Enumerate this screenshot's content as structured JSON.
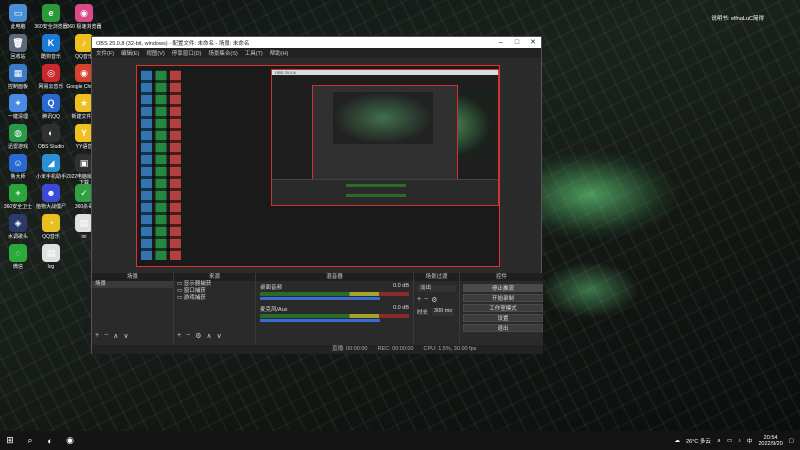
{
  "desktop": {
    "user_label": "说明书: elfnaLuC简得",
    "icons": [
      {
        "label": "此电脑",
        "glyph": "▭",
        "color": "#4a8fd6"
      },
      {
        "label": "360安全浏览器",
        "glyph": "e",
        "color": "#2b9b3a"
      },
      {
        "label": "360 极速浏览器",
        "glyph": "◉",
        "color": "#d84a8a"
      },
      {
        "label": "回收站",
        "glyph": "🗑",
        "color": "#5a6a7a"
      },
      {
        "label": "酷狗音乐",
        "glyph": "K",
        "color": "#1a7ad6"
      },
      {
        "label": "QQ音乐",
        "glyph": "♪",
        "color": "#f0c020"
      },
      {
        "label": "控制面板",
        "glyph": "▦",
        "color": "#3a7ac6"
      },
      {
        "label": "网易云音乐",
        "glyph": "◎",
        "color": "#c8282e"
      },
      {
        "label": "Google Chrome",
        "glyph": "◉",
        "color": "#d84030"
      },
      {
        "label": "一键清理",
        "glyph": "✦",
        "color": "#4a8ae6"
      },
      {
        "label": "腾讯QQ",
        "glyph": "Q",
        "color": "#2a6ad0"
      },
      {
        "label": "新建文件夹",
        "glyph": "★",
        "color": "#f0c020"
      },
      {
        "label": "迅雷游戏",
        "glyph": "◍",
        "color": "#2a9a4a"
      },
      {
        "label": "OBS Studio",
        "glyph": "◐",
        "color": "#303030"
      },
      {
        "label": "YY语音",
        "glyph": "Y",
        "color": "#f0c020"
      },
      {
        "label": "鲁大师",
        "glyph": "☺",
        "color": "#2a6ad0"
      },
      {
        "label": "小米手机助手",
        "glyph": "◢",
        "color": "#2a90d6"
      },
      {
        "label": "2022电脑版软件下载",
        "glyph": "▣",
        "color": "#303030"
      },
      {
        "label": "360安全卫士",
        "glyph": "+",
        "color": "#2aa53a"
      },
      {
        "label": "植物大战僵尸",
        "glyph": "☻",
        "color": "#3a4ad6"
      },
      {
        "label": "360杀毒",
        "glyph": "✓",
        "color": "#30a040"
      },
      {
        "label": "水调歌头",
        "glyph": "◈",
        "color": "#2a3a6a"
      },
      {
        "label": "QQ音乐",
        "glyph": "◔",
        "color": "#e8c020"
      },
      {
        "label": "ini",
        "glyph": "▤",
        "color": "#e0e0e0"
      },
      {
        "label": "微信",
        "glyph": "◌",
        "color": "#2aaa3a"
      },
      {
        "label": "log",
        "glyph": "▤",
        "color": "#e0e0e0"
      }
    ]
  },
  "obs": {
    "title": "OBS 25.0.8 (32-bit, windows) - 配置文件: 未命名 - 场景: 未命名",
    "menu": [
      "文件(F)",
      "编辑(E)",
      "视图(V)",
      "停靠窗口(D)",
      "场景集合(S)",
      "工具(T)",
      "帮助(H)"
    ],
    "nested_title": "OBS 25.0.8",
    "docks": {
      "scenes_header": "场景",
      "sources_header": "来源",
      "mixer_header": "混音器",
      "transitions_header": "场景过渡",
      "controls_header": "控件",
      "scene_items": [
        "场景"
      ],
      "source_items": [
        "显示器捕获",
        "窗口捕获",
        "游戏捕获"
      ],
      "mixer_channels": [
        {
          "name": "桌面音频",
          "db": "0.0 dB",
          "level": 0.62
        },
        {
          "name": "麦克风/Aux",
          "db": "0.0 dB",
          "level": 0.55
        }
      ],
      "transition_type": "淡出",
      "duration_label": "时长",
      "duration_value": "300 ms",
      "controls": [
        "停止推流",
        "开始录制",
        "工作室模式",
        "设置",
        "退出"
      ]
    },
    "status": {
      "live": "直播: 00:00:00",
      "rec": "REC: 00:00:00",
      "cpu": "CPU: 1.5%, 30.00 fps"
    }
  },
  "taskbar": {
    "weather": "26°C 多云",
    "ime": "中",
    "time": "20:54",
    "date": "2022/9/20"
  }
}
